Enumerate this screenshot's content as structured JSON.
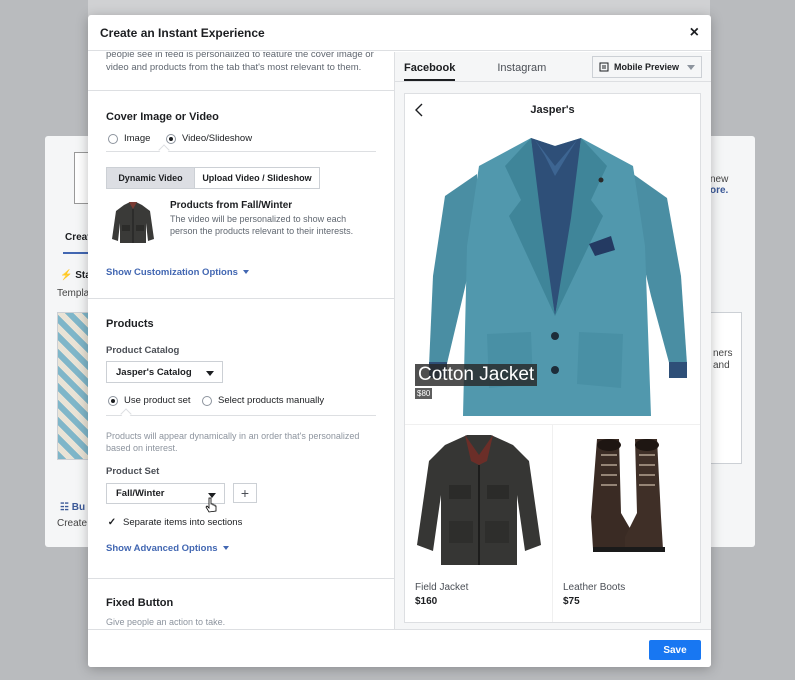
{
  "background": {
    "tab_partial": "Creat",
    "row1": "Sta",
    "row2": "Templa",
    "right1": "new",
    "right2": "ore.",
    "right3": "ners",
    "right4": "and",
    "bottom_link": "Bu",
    "bottom_text": "Create"
  },
  "modal": {
    "title": "Create an Instant Experience",
    "close_label": "×",
    "save_label": "Save"
  },
  "intro_text": "people see in feed is personalized to feature the cover image or video and products from the tab that's most relevant to them.",
  "cover": {
    "title": "Cover Image or Video",
    "options": [
      "Image",
      "Video/Slideshow"
    ],
    "selected": "Video/Slideshow",
    "segments": [
      "Dynamic Video",
      "Upload Video / Slideshow"
    ],
    "active_segment": "Dynamic Video",
    "product_title": "Products from Fall/Winter",
    "product_desc": "The video will be personalized to show each person the products relevant to their interests.",
    "customize_link": "Show Customization Options"
  },
  "products": {
    "title": "Products",
    "catalog_label": "Product Catalog",
    "catalog_value": "Jasper's Catalog",
    "options": [
      "Use product set",
      "Select products manually"
    ],
    "selected": "Use product set",
    "help_text": "Products will appear dynamically in an order that's personalized based on interest.",
    "set_label": "Product Set",
    "set_value": "Fall/Winter",
    "plus_label": "+",
    "separate_label": "Separate items into sections",
    "separate_checked": true,
    "advanced_link": "Show Advanced Options"
  },
  "fixed_button": {
    "title": "Fixed Button",
    "desc": "Give people an action to take."
  },
  "preview": {
    "tabs": [
      "Facebook",
      "Instagram"
    ],
    "active_tab": "Facebook",
    "device": "Mobile Preview",
    "brand": "Jasper's",
    "hero_title": "Cotton Jacket",
    "hero_price": "$80",
    "items": [
      {
        "name": "Field Jacket",
        "price": "$160"
      },
      {
        "name": "Leather Boots",
        "price": "$75"
      }
    ]
  },
  "colors": {
    "accent": "#1877f2",
    "link": "#4267b2",
    "jacket": "#4e93a8"
  }
}
